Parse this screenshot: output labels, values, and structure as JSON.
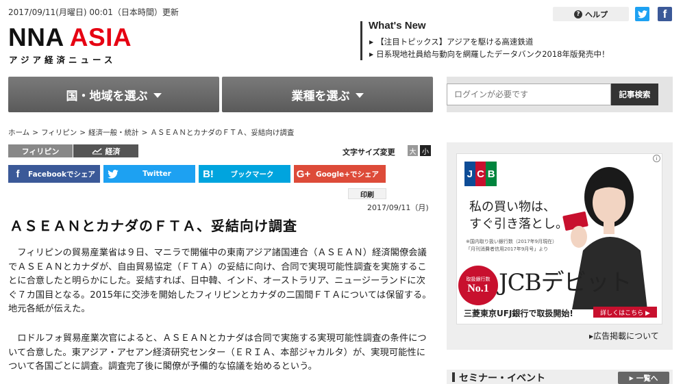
{
  "header": {
    "datetime": "2017/09/11(月曜日) 00:01（日本時間）更新",
    "logo_main": "NNA",
    "logo_accent": "ASIA",
    "logo_sub": "アジア経済ニュース",
    "help_label": "ヘルプ"
  },
  "whats_new": {
    "title": "What's New",
    "items": [
      "【注目トピックス】アジアを駆ける高速鉄道",
      "日系現地社員給与動向を網羅したデータバンク2018年版発売中！"
    ]
  },
  "nav": {
    "region_label": "国・地域を選ぶ",
    "industry_label": "業種を選ぶ"
  },
  "search": {
    "placeholder": "ログインが必要です",
    "button_label": "記事検索"
  },
  "breadcrumb": [
    "ホーム",
    "フィリピン",
    "経済一般・統計",
    "ＡＳＥＡＮとカナダのＦＴＡ、妥結向け調査"
  ],
  "tags": {
    "country": "フィリピン",
    "industry": "経済"
  },
  "font_size": {
    "label": "文字サイズ変更",
    "large": "大",
    "small": "小"
  },
  "share": {
    "facebook": "Facebookでシェア",
    "twitter": "Twitter",
    "hatena": "ブックマーク",
    "google": "Google+でシェア"
  },
  "article": {
    "print_label": "印刷",
    "date": "2017/09/11（月)",
    "title": "ＡＳＥＡＮとカナダのＦＴＡ、妥結向け調査",
    "paragraphs": [
      "フィリピンの貿易産業省は９日、マニラで開催中の東南アジア諸国連合（ＡＳＥＡＮ）経済閣僚会議でＡＳＥＡＮとカナダが、自由貿易協定（ＦＴＡ）の妥結に向け、合同で実現可能性調査を実施することに合意したと明らかにした。妥結すれば、日中韓、インド、オーストラリア、ニュージーランドに次ぐ７カ国目となる。2015年に交渉を開始したフィリピンとカナダの二国間ＦＴＡについては保留する。地元各紙が伝えた。",
      "ロドルフォ貿易産業次官によると、ＡＳＥＡＮとカナダは合同で実施する実現可能性調査の条件について合意した。東アジア・アセアン経済研究センター（ＥＲＩＡ、本部ジャカルタ）が、実現可能性について各国ごとに調査。調査完了後に閣僚が予備的な協議を始めるという。"
    ]
  },
  "ad": {
    "logo_letters": [
      "J",
      "C",
      "B"
    ],
    "headline_1": "私の買い物は、",
    "headline_2": "すぐ引き落とし。",
    "note_1": "※国内取り扱い銀行数（2017年9月現在）",
    "note_2": "「月刊消費者信用2017年9月号」より",
    "badge_small": "取扱銀行数",
    "badge_big": "No.1",
    "product": "JCBデビット",
    "bank": "三菱東京UFJ銀行で取扱開始!",
    "cta": "詳しくはこちら ▶",
    "footer_link": "広告掲載について"
  },
  "seminar": {
    "title": "セミナー・イベント",
    "more_label": "一覧へ"
  },
  "colors": {
    "brand_red": "#e60012",
    "facebook": "#3b5998",
    "twitter": "#1da1f2",
    "hatena": "#00a4de",
    "google": "#dd4b39"
  }
}
